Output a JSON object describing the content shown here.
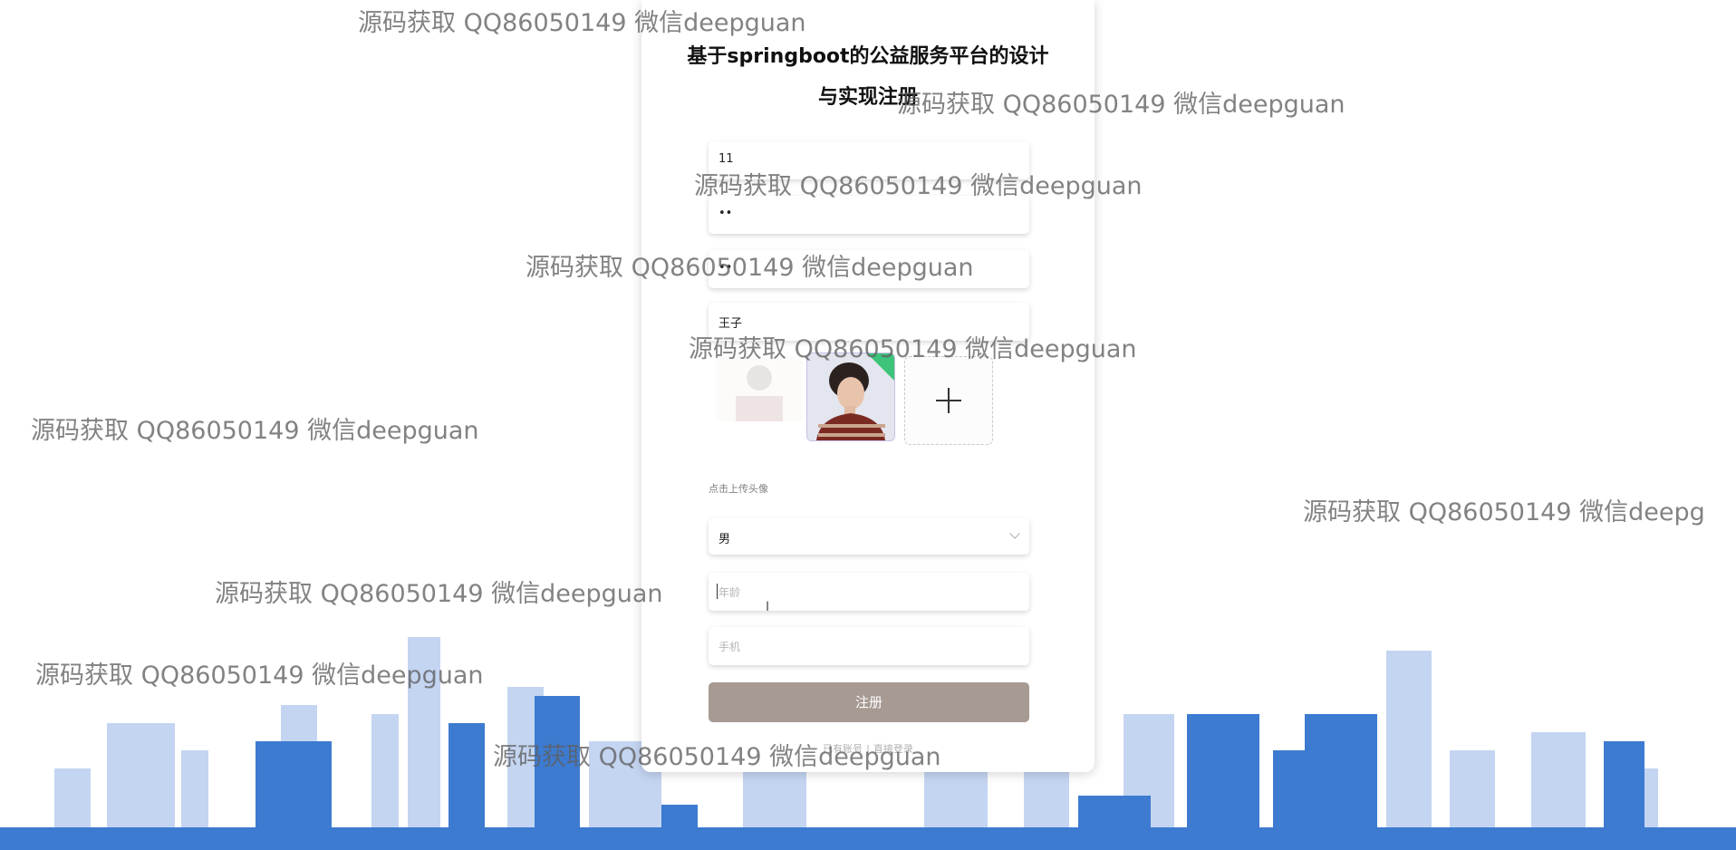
{
  "page": {
    "title": "基于springboot的公益服务平台的设计与实现注册"
  },
  "form": {
    "account_value": "11",
    "password_value": "••",
    "confirm_password_value": "••",
    "name_value": "王子",
    "upload_hint": "点击上传头像",
    "gender_value": "男",
    "age_placeholder": "年龄",
    "phone_placeholder": "手机",
    "register_label": "注册",
    "login_prefix": "已有账号",
    "login_link": "直接登录"
  },
  "watermark": {
    "text": "源码获取 QQ86050149 微信deepguan",
    "partial_text": "源码获取 QQ86050149 微信deepg"
  },
  "icons": {
    "upload": "plus-icon",
    "select": "chevron-down-icon",
    "cursor": "text-cursor-icon"
  },
  "colors": {
    "register_button": "#a69a93",
    "skyline_blue": "#3d7bd1",
    "skyline_light": "#b8cdee"
  }
}
